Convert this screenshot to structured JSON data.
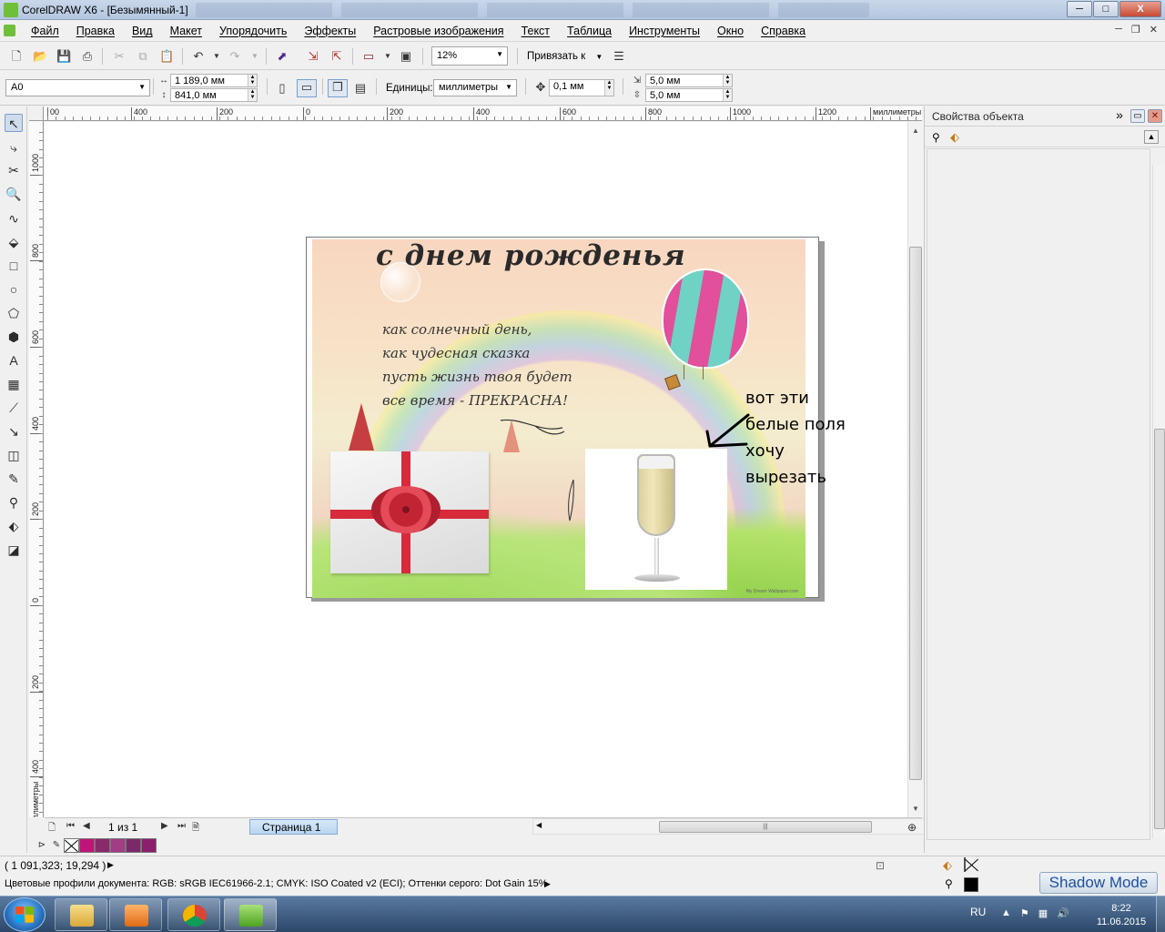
{
  "window": {
    "title": "CorelDRAW X6 - [Безымянный-1]",
    "controls": {
      "minimize": "─",
      "maximize": "□",
      "close": "X"
    }
  },
  "menu": {
    "items": [
      "Файл",
      "Правка",
      "Вид",
      "Макет",
      "Упорядочить",
      "Эффекты",
      "Растровые изображения",
      "Текст",
      "Таблица",
      "Инструменты",
      "Окно",
      "Справка"
    ],
    "mdi_controls": {
      "minimize": "─",
      "restore": "❐",
      "close": "✕"
    }
  },
  "standard_toolbar": {
    "zoom": "12%",
    "snap_to": "Привязать к"
  },
  "property_bar": {
    "page_size": "A0",
    "width": "1 189,0 мм",
    "height": "841,0 мм",
    "units_label": "Единицы:",
    "units_value": "миллиметры",
    "nudge": "0,1 мм",
    "dup_x": "5,0 мм",
    "dup_y": "5,0 мм"
  },
  "rulers": {
    "top": [
      "00",
      "400",
      "200",
      "0",
      "200",
      "400",
      "600",
      "800",
      "1000",
      "1200",
      "миллиметры"
    ],
    "left": [
      "1000",
      "800",
      "600",
      "400",
      "200",
      "0",
      "200",
      "400",
      "миллиметры"
    ]
  },
  "artwork": {
    "title": "с днем рожденья",
    "poem": [
      "как солнечный день,",
      "как чудесная сказка",
      "пусть жизнь твоя будет",
      "все время - ПРЕКРАСНА!"
    ],
    "watermark": "My Dream Wallpaper.com"
  },
  "annotation": {
    "lines": [
      "вот эти",
      "белые поля",
      "хочу",
      "вырезать"
    ]
  },
  "page_nav": {
    "count": "1 из 1",
    "tab": "Страница 1"
  },
  "palette": {
    "colors": [
      "#c0147a",
      "#8a2a6a",
      "#a23c86",
      "#7a2a68",
      "#8c1e6e"
    ]
  },
  "docker": {
    "title": "Свойства объекта",
    "collapse": "»"
  },
  "status": {
    "coords": "( 1 091,323; 19,294 )",
    "profiles": "Цветовые профили документа: RGB: sRGB IEC61966-2.1; CMYK: ISO Coated v2 (ECI); Оттенки серого: Dot Gain 15%",
    "fill_color": "#000000"
  },
  "shadow_mode": "Shadow Mode",
  "taskbar": {
    "lang": "RU",
    "time": "8:22",
    "date": "11.06.2015"
  }
}
